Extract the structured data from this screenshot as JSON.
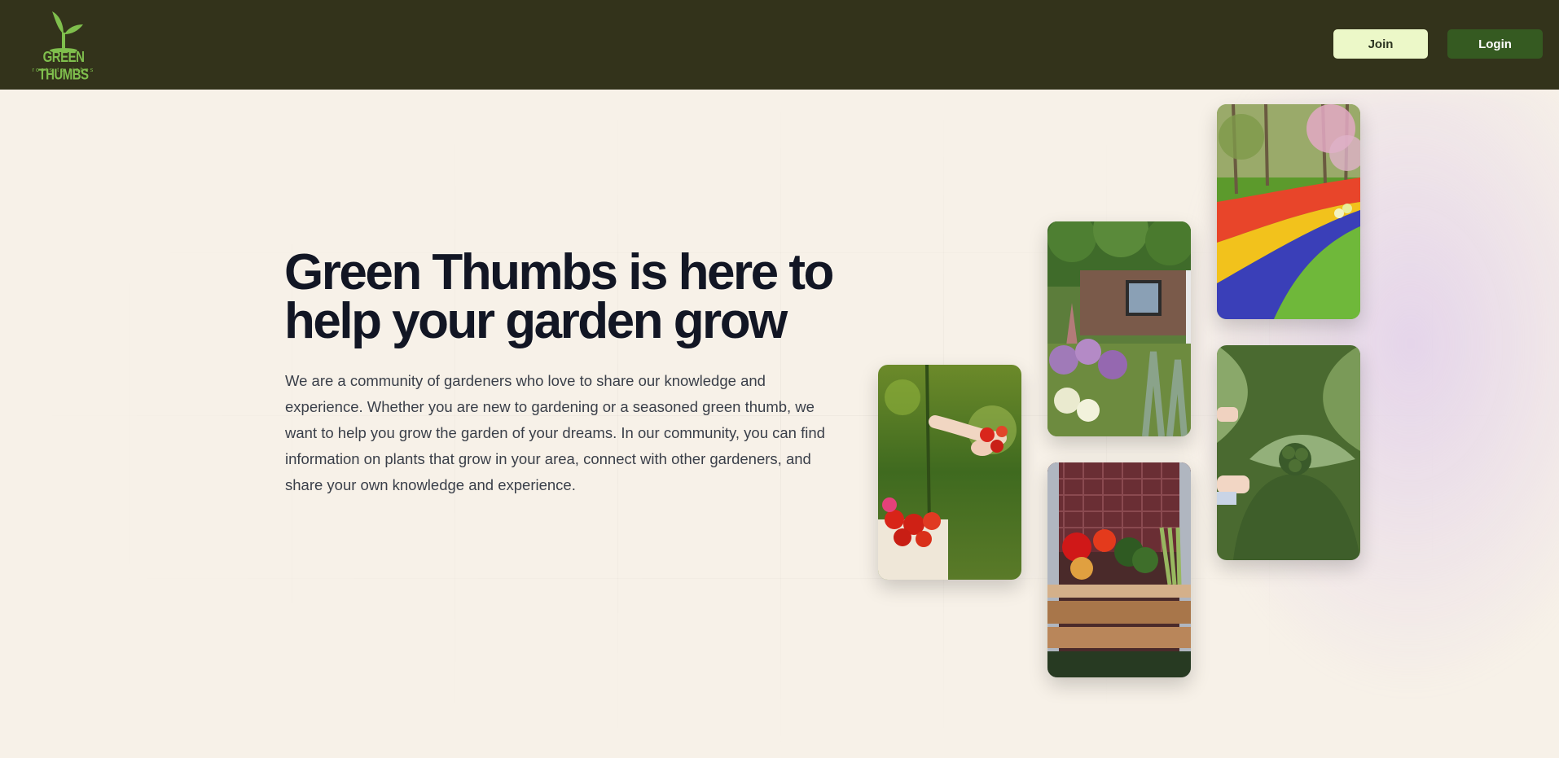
{
  "header": {
    "logo": {
      "title": "GREEN THUMBS",
      "tagline": "roots to riches",
      "icon": "sprout-icon",
      "color": "#7fbf4d"
    },
    "join_label": "Join",
    "login_label": "Login",
    "background": "#33331b"
  },
  "hero": {
    "headline": "Green Thumbs is here to help your garden grow",
    "description": "We are a community of gardeners who love to share our knowledge and experience. Whether you are new to gardening or a seasoned green thumb, we want to help you grow the garden of your dreams. In our community, you can find information on plants that grow in your area, connect with other gardeners, and share your own knowledge and experience.",
    "images": [
      {
        "subject": "hand picking tomatoes"
      },
      {
        "subject": "cottage flower garden"
      },
      {
        "subject": "crate of vegetables"
      },
      {
        "subject": "tulip flower park"
      },
      {
        "subject": "broccoli plant"
      }
    ]
  },
  "colors": {
    "page_background": "#f7f1e8",
    "join_button": "#ecf8c8",
    "login_button": "#355a21",
    "headline": "#121624",
    "body_text": "#3a3f49"
  }
}
